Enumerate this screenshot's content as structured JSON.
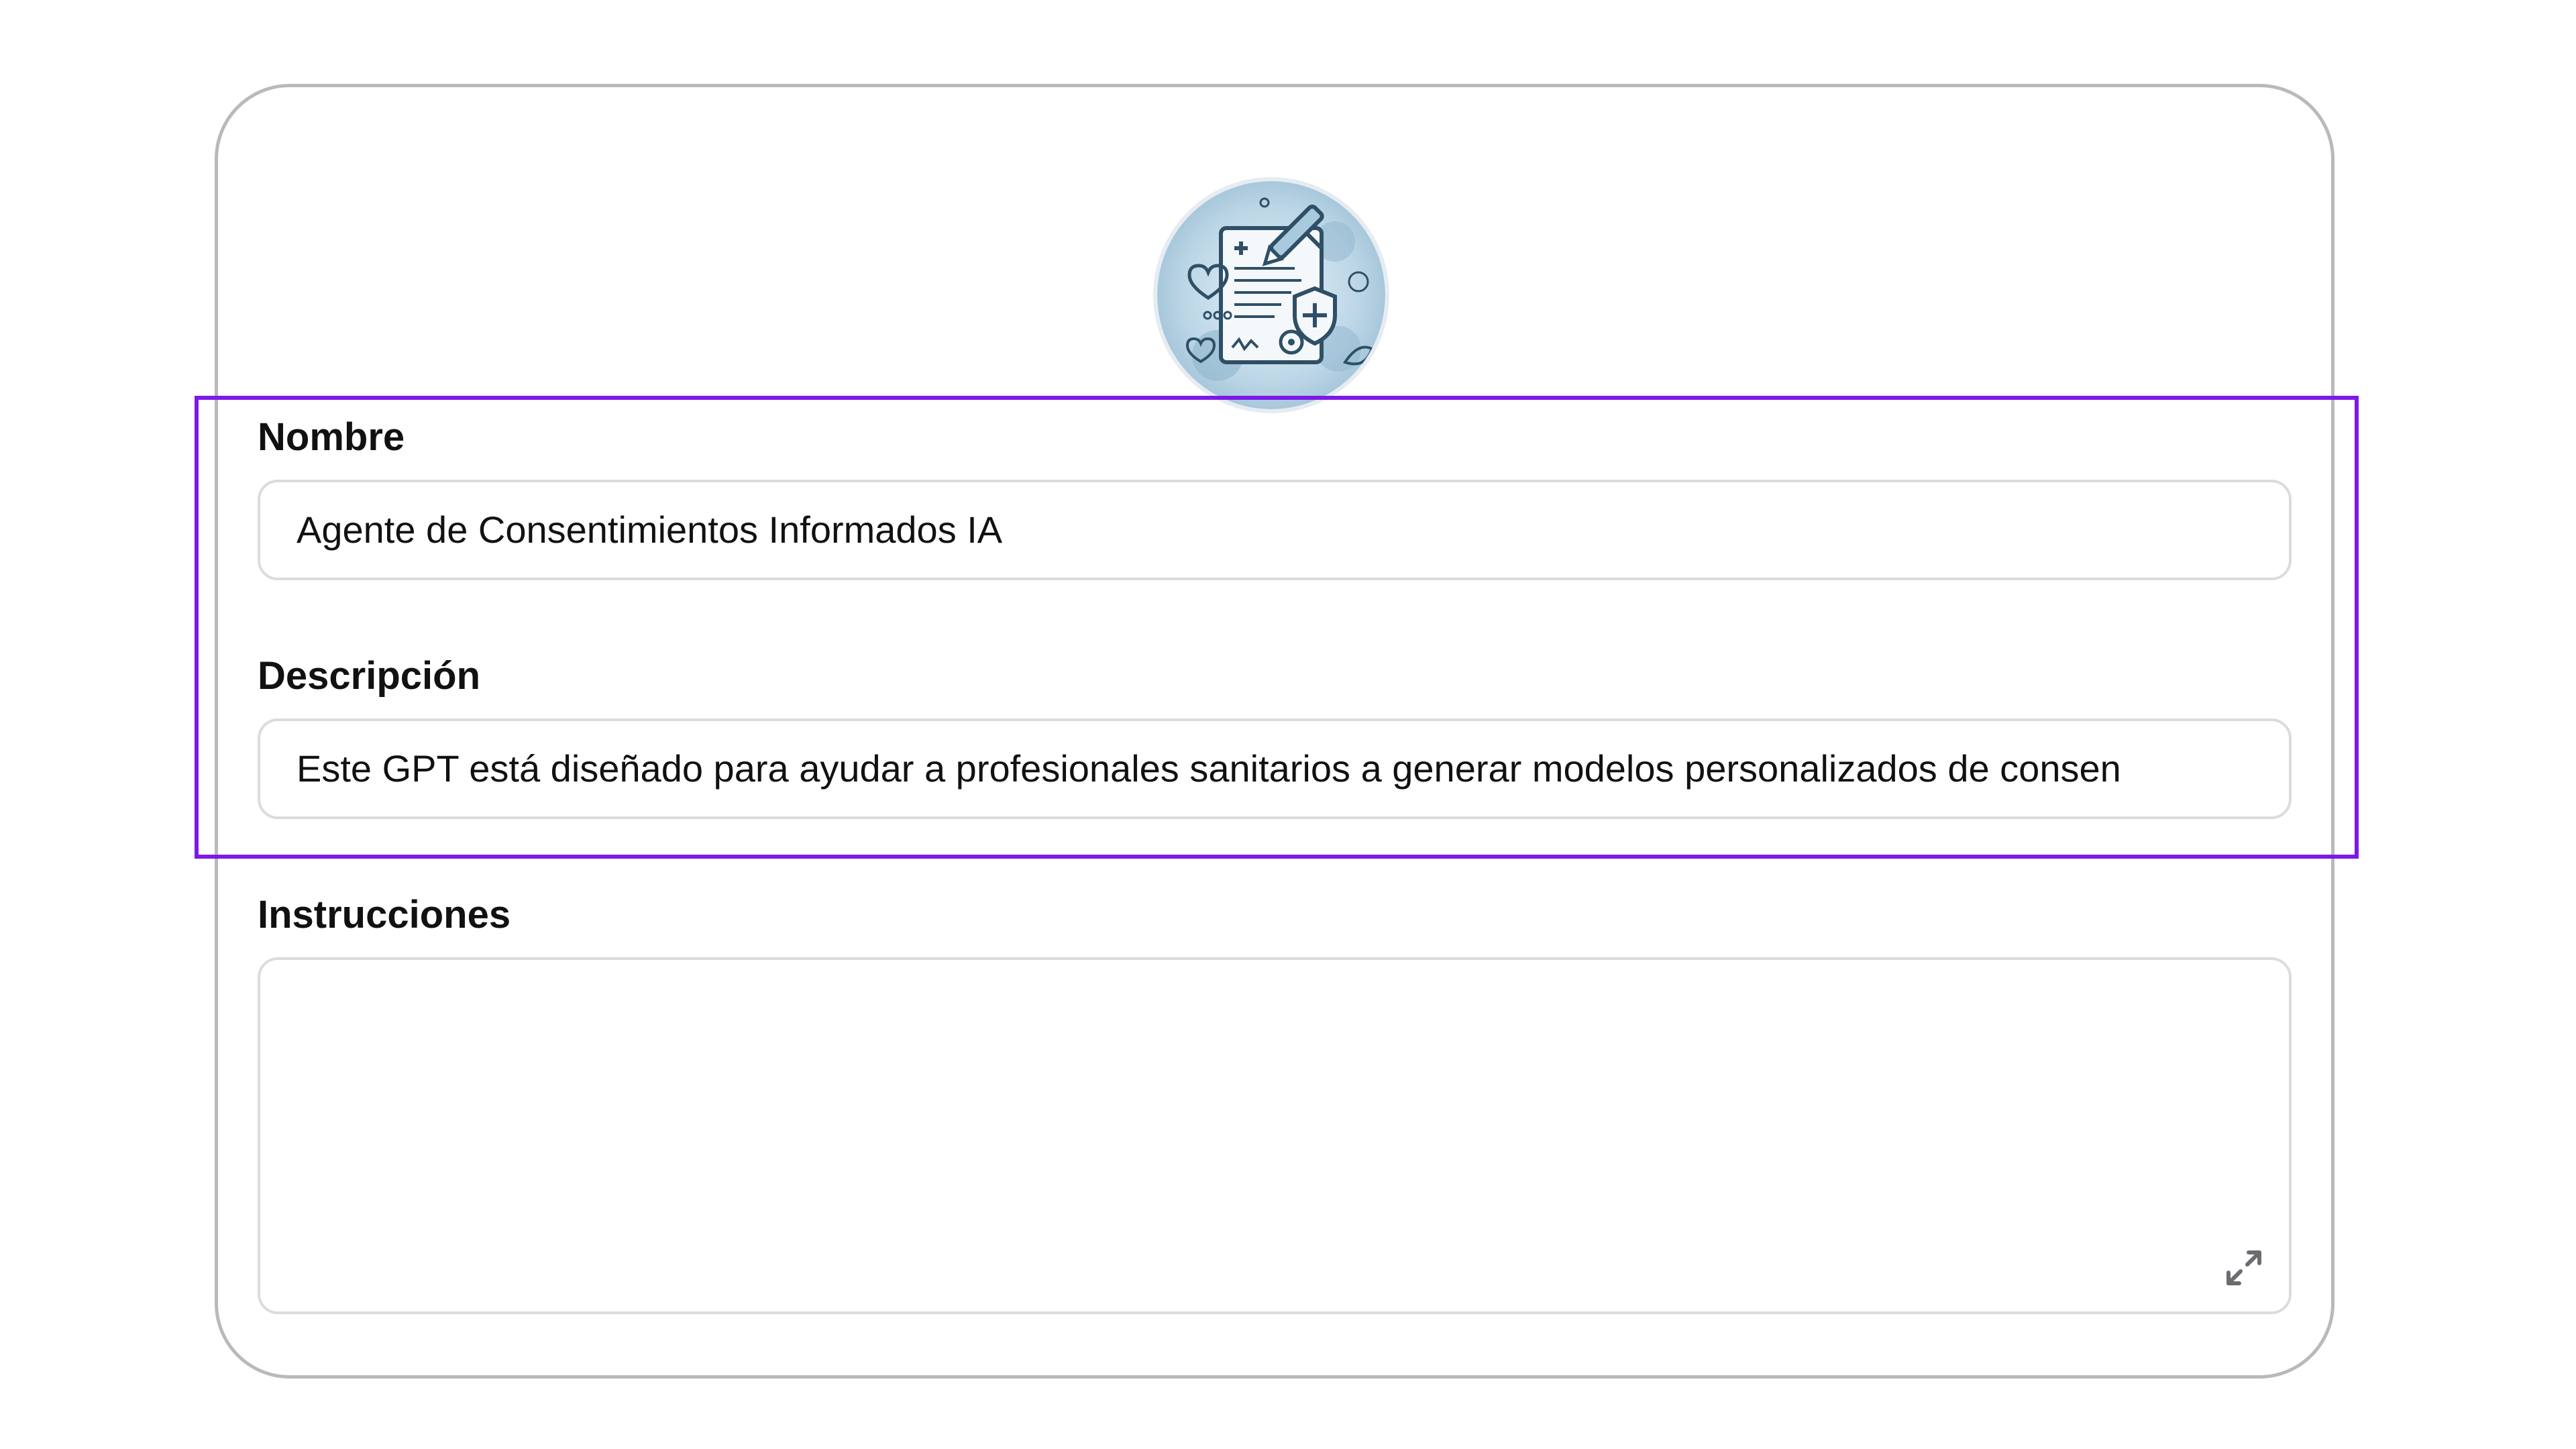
{
  "avatar": {
    "icon": "medical-consent-document-icon",
    "colors": {
      "circle": "#a9c9dc",
      "line": "#2f4f66",
      "paper": "#f4f8fb"
    }
  },
  "form": {
    "name_label": "Nombre",
    "name_value": "Agente de Consentimientos Informados IA",
    "description_label": "Descripción",
    "description_value": "Este GPT está diseñado para ayudar a profesionales sanitarios a generar modelos personalizados de consen",
    "instructions_label": "Instrucciones",
    "instructions_value": "",
    "expand_icon": "expand-icon"
  },
  "highlight": {
    "color": "#7d19e8"
  }
}
